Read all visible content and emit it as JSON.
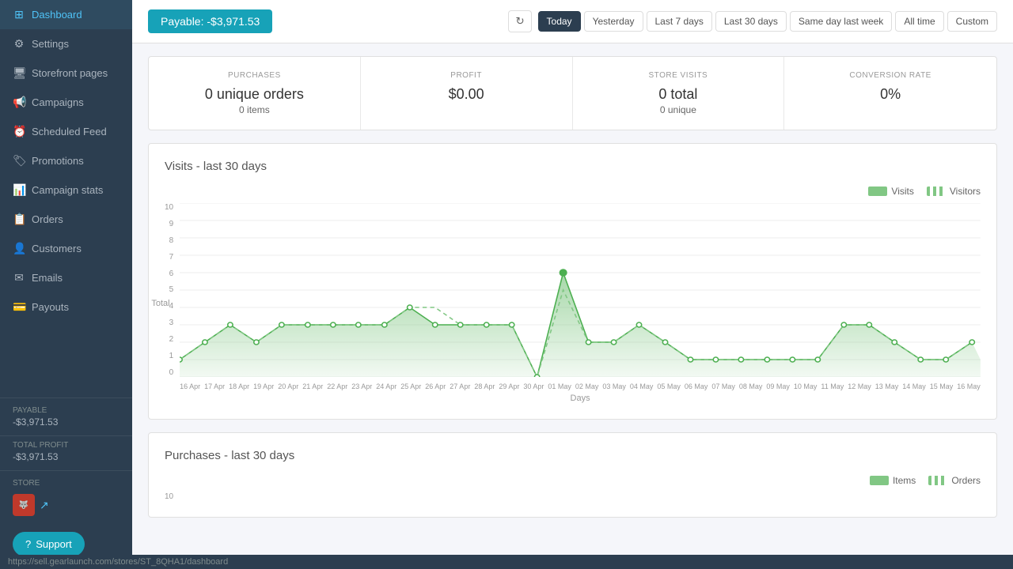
{
  "sidebar": {
    "items": [
      {
        "id": "dashboard",
        "label": "Dashboard",
        "icon": "⊞",
        "active": true
      },
      {
        "id": "settings",
        "label": "Settings",
        "icon": "⚙"
      },
      {
        "id": "storefront",
        "label": "Storefront pages",
        "icon": "🖥"
      },
      {
        "id": "campaigns",
        "label": "Campaigns",
        "icon": "📢"
      },
      {
        "id": "scheduled-feed",
        "label": "Scheduled Feed",
        "icon": "⏰"
      },
      {
        "id": "promotions",
        "label": "Promotions",
        "icon": "🏷"
      },
      {
        "id": "campaign-stats",
        "label": "Campaign stats",
        "icon": "📊"
      },
      {
        "id": "orders",
        "label": "Orders",
        "icon": "📋"
      },
      {
        "id": "customers",
        "label": "Customers",
        "icon": "👤"
      },
      {
        "id": "emails",
        "label": "Emails",
        "icon": "✉"
      },
      {
        "id": "payouts",
        "label": "Payouts",
        "icon": "💳"
      }
    ],
    "payable_label": "PAYABLE",
    "payable_value": "-$3,971.53",
    "total_profit_label": "TOTAL PROFIT",
    "total_profit_value": "-$3,971.53",
    "store_label": "STORE",
    "support_label": "Support"
  },
  "topbar": {
    "payable_badge": "Payable: -$3,971.53",
    "refresh_icon": "↻",
    "time_filters": [
      {
        "label": "Today",
        "active": true
      },
      {
        "label": "Yesterday",
        "active": false
      },
      {
        "label": "Last 7 days",
        "active": false
      },
      {
        "label": "Last 30 days",
        "active": false
      },
      {
        "label": "Same day last week",
        "active": false
      },
      {
        "label": "All time",
        "active": false
      },
      {
        "label": "Custom",
        "active": false
      }
    ]
  },
  "stats": [
    {
      "label": "PURCHASES",
      "main": "0 unique orders",
      "sub": "0 items"
    },
    {
      "label": "PROFIT",
      "main": "$0.00",
      "sub": ""
    },
    {
      "label": "STORE VISITS",
      "main": "0 total",
      "sub": "0 unique"
    },
    {
      "label": "CONVERSION RATE",
      "main": "0%",
      "sub": ""
    }
  ],
  "visits_chart": {
    "title": "Visits - last 30 days",
    "legend": [
      {
        "label": "Visits",
        "type": "solid"
      },
      {
        "label": "Visitors",
        "type": "dashed"
      }
    ],
    "y_axis_label": "Total",
    "x_axis_label": "Days",
    "y_max": 10,
    "x_labels": [
      "16 Apr",
      "17 Apr",
      "18 Apr",
      "19 Apr",
      "20 Apr",
      "21 Apr",
      "22 Apr",
      "23 Apr",
      "24 Apr",
      "25 Apr",
      "26 Apr",
      "27 Apr",
      "28 Apr",
      "29 Apr",
      "30 Apr",
      "01 May",
      "02 May",
      "03 May",
      "04 May",
      "05 May",
      "06 May",
      "07 May",
      "08 May",
      "09 May",
      "10 May",
      "11 May",
      "12 May",
      "13 May",
      "14 May",
      "15 May",
      "16 May"
    ]
  },
  "purchases_chart": {
    "title": "Purchases - last 30 days",
    "legend": [
      {
        "label": "Items",
        "type": "solid"
      },
      {
        "label": "Orders",
        "type": "dashed"
      }
    ],
    "y_max": 10
  },
  "bottom_bar": {
    "url": "https://sell.gearlaunch.com/stores/ST_8QHA1/dashboard"
  }
}
